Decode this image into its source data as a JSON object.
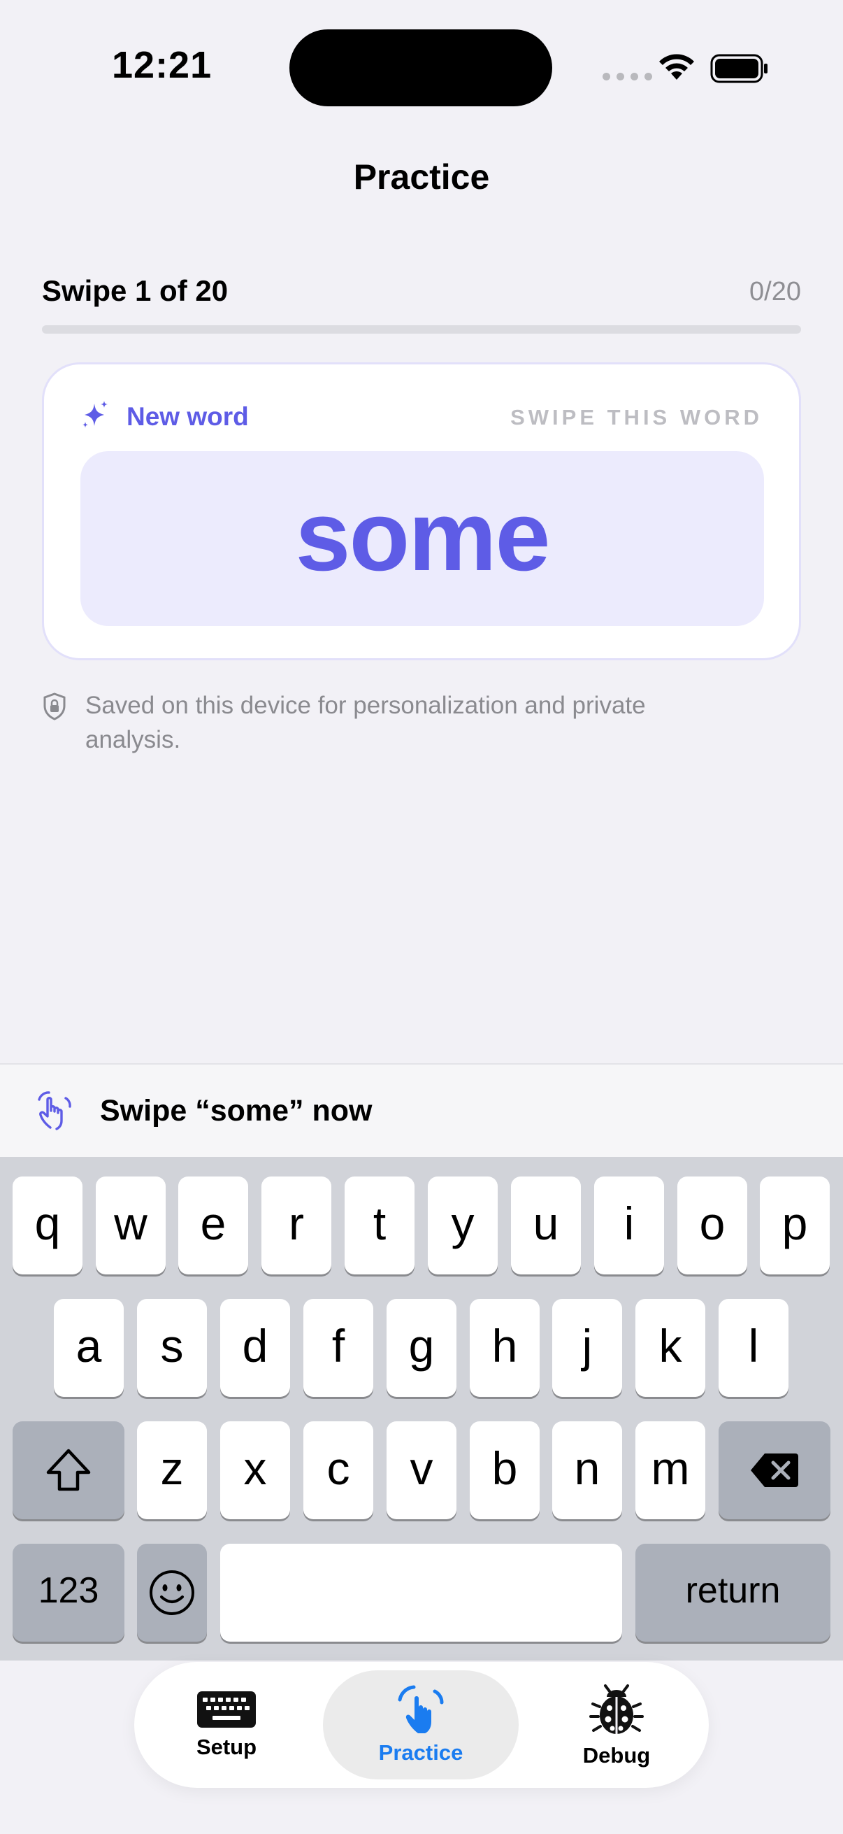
{
  "status_bar": {
    "time": "12:21"
  },
  "nav": {
    "title": "Practice"
  },
  "progress": {
    "label": "Swipe 1 of 20",
    "count": "0/20",
    "fraction": 0
  },
  "card": {
    "badge": "New word",
    "hint": "SWIPE THIS WORD",
    "word": "some"
  },
  "privacy_note": "Saved on this device for personalization and private analysis.",
  "prompt": {
    "text": "Swipe “some” now"
  },
  "keyboard": {
    "row1": [
      "q",
      "w",
      "e",
      "r",
      "t",
      "y",
      "u",
      "i",
      "o",
      "p"
    ],
    "row2": [
      "a",
      "s",
      "d",
      "f",
      "g",
      "h",
      "j",
      "k",
      "l"
    ],
    "row3": [
      "z",
      "x",
      "c",
      "v",
      "b",
      "n",
      "m"
    ],
    "numbers_label": "123",
    "return_label": "return"
  },
  "tabs": [
    {
      "label": "Setup",
      "icon": "keyboard-icon"
    },
    {
      "label": "Practice",
      "icon": "hand-swipe-icon",
      "active": true
    },
    {
      "label": "Debug",
      "icon": "ladybug-icon"
    }
  ],
  "colors": {
    "accent": "#5e5ce6",
    "tab_active": "#1a7cf0"
  }
}
